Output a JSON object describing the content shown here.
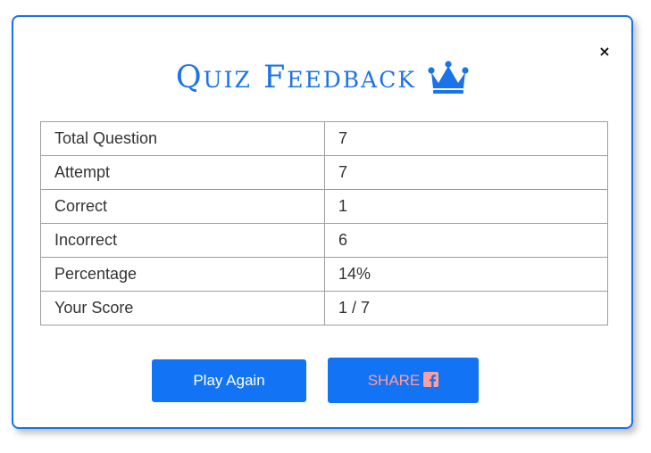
{
  "dialog": {
    "title": "Quiz Feedback",
    "close_label": "×",
    "title_icon": "crown-icon"
  },
  "stats": [
    {
      "label": "Total Question",
      "value": "7"
    },
    {
      "label": "Attempt",
      "value": "7"
    },
    {
      "label": "Correct",
      "value": "1"
    },
    {
      "label": "Incorrect",
      "value": "6"
    },
    {
      "label": "Percentage",
      "value": "14%"
    },
    {
      "label": "Your Score",
      "value": "1 / 7"
    }
  ],
  "actions": {
    "play_again_label": "Play Again",
    "share_label": "SHARE",
    "share_icon": "facebook-icon"
  },
  "colors": {
    "accent": "#1a73e8",
    "button_bg": "#1273f5",
    "share_text": "#ff9e9e",
    "border": "#9e9e9e"
  }
}
